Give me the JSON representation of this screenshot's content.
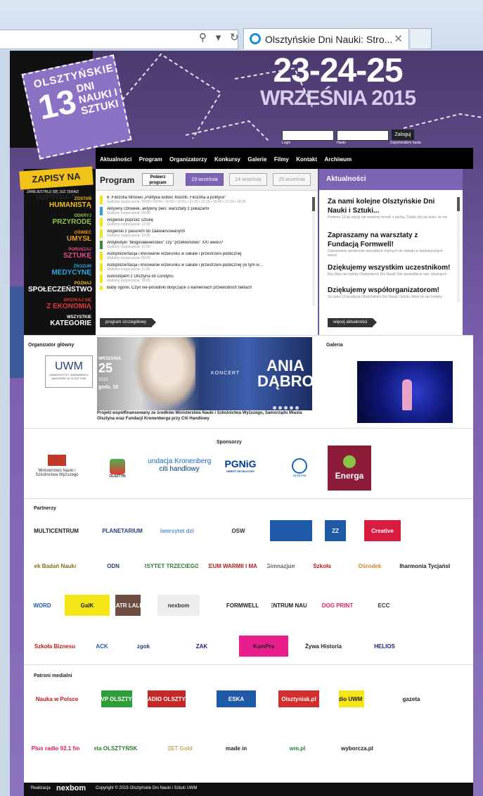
{
  "browser": {
    "tab_title": "Olsztyńskie Dni Nauki: Stro...",
    "tab_close": "✕",
    "url_icons": "⚲ ▾ ↻"
  },
  "header": {
    "logo_line1": "OLSZTYŃSKIE",
    "logo_number": "13",
    "logo_line2": "DNI NAUKI I SZTUKI",
    "dates": "23-24-25",
    "month": "WRZEŚNIA 2015",
    "login_button": "Zaloguj",
    "login_label": "Login",
    "password_label": "Hasło",
    "forgot_label": "Zapomniałem hasła"
  },
  "facebook_label": "facebook",
  "sidebar": {
    "signup": "ZAPISY NA IMPREZY!",
    "signup_sub": "ZAREJESTRUJ SIĘ JUŻ TERAZ!",
    "items": [
      {
        "a": "ZOSTAŃ",
        "b": "HUMANISTĄ"
      },
      {
        "a": "ODKRYJ",
        "b": "PRZYRODĘ"
      },
      {
        "a": "OŚWIEĆ",
        "b": "UMYSŁ"
      },
      {
        "a": "PORUSZAJ",
        "b": "SZTUKĘ"
      },
      {
        "a": "ZROZUM",
        "b": "MEDYCYNĘ"
      },
      {
        "a": "POZNAJ",
        "b": "SPOŁECZEŃSTWO"
      },
      {
        "a": "SPOTKAJ SIĘ",
        "b": "Z EKONOMIĄ"
      },
      {
        "a": "WSZYSTKIE",
        "b": "KATEGORIE"
      }
    ]
  },
  "nav": [
    "Aktualności",
    "Program",
    "Organizatorzy",
    "Konkursy",
    "Galerie",
    "Filmy",
    "Kontakt",
    "Archiwum"
  ],
  "program": {
    "title": "Program",
    "download": "Pobierz program",
    "days": [
      "23 września",
      "24 września",
      "25 września"
    ],
    "events": [
      {
        "title": "6. Filozofia filmowo „Polityka wobec filozofii. Filozofia a polityce\"",
        "hours": "Godziny rozpoczęcia: 09:00 • 09:45 • 10:15 • 10:50 • 11:25 • 12:15 • 16:00 • 17:10 • 18:30",
        "color": "#f5e619"
      },
      {
        "title": "Aktywny człowiek, aktywny pies: warsztaty z pokazami",
        "hours": "Godziny rozpoczęcia: 09:00",
        "color": "#2f9fdd"
      },
      {
        "title": "Angielski poprzez sztukę",
        "hours": "Godziny rozpoczęcia: 12:00",
        "color": "#f5e619"
      },
      {
        "title": "Angielski z pasurem do zaawansowanych",
        "hours": "Godziny rozpoczęcia: 10:30",
        "color": "#f5e619"
      },
      {
        "title": "Antybiotyki \"błogosławieństwo\" czy \"przekleństwo\" XXI wieku?",
        "hours": "Godziny rozpoczęcia: 10:30",
        "color": "#2f8f3a"
      },
      {
        "title": "Autoprezentacja i kreowanie wizerunku w sakale i przestrzeni publicznej",
        "hours": "Godziny rozpoczęcia: 09:30",
        "color": "#f5e619"
      },
      {
        "title": "Autoprezentacja i kreowanie wizerunku w sakale i przestrzeni publicznej (w tym w...",
        "hours": "Godziny rozpoczęcia: 11:30",
        "color": "#f5e619"
      },
      {
        "title": "Autostopem z Olsztyna do Londynu",
        "hours": "Godziny rozpoczęcia: 10:00",
        "color": "#f5e619"
      },
      {
        "title": "Baby ogórki. Czyli nie-poradniki dotyczące o kamieniach przewodnich faktach",
        "hours": "",
        "color": "#f5e619"
      }
    ],
    "detail_button": "program szczegółowy"
  },
  "news": {
    "title": "Aktualności",
    "items": [
      {
        "h": "Za nami kolejne Olsztyńskie Dni Nauki i Sztuki...",
        "d": "Pomimo 13-tej edycji nie możemy mówić o pechu. Dzięki obj się dużo, że nie"
      },
      {
        "h": "Zapraszamy na warsztaty z Fundacją Formwell!",
        "d": "Zapraszamy serdecznie wszystkich chętnych do udziału w fantastycznych warsz"
      },
      {
        "h": "Dziękujemy wszystkim uczestnikom!",
        "d": "Bez Was nie byłoby Olsztyńskich Dni Nauki! Nie zawiedliście nas, dziękujem"
      },
      {
        "h": "Dziękujemy współorganizatorom!",
        "d": "Za nami 13-ta edycja Olsztyńskich Dni Nauki i Sztuki, które po raz kolejny"
      }
    ],
    "more_button": "więcej aktualności"
  },
  "organizer": {
    "label": "Organizator główny",
    "logo": "UWM",
    "logo_sub": "UNIWERSYTET WARMIŃSKO-MAZURSKI W OLSZTYNIE"
  },
  "banner": {
    "day": "25",
    "month": "WRZEŚNIA",
    "year": "2015",
    "hour": "godz. 18",
    "concert": "KONCERT",
    "artist": "ANIA DĄBROWSKA",
    "caption": "Projekt współfinansowany ze środków Ministerstwa Nauki i Szkolnictwa Wyższego, Samorządu Miasta Olsztyna oraz Fundacji Kronenberga przy Citi Handlowy"
  },
  "gallery": {
    "label": "Galeria"
  },
  "sponsors": {
    "label": "Sponsorzy",
    "ministry": "Ministerstwo Nauki i Szkolnictwa Wyższego",
    "olsztyn": "OLSZTYN",
    "kronenberg": "Fundacja Kronenberga",
    "citi": "citi handlowy",
    "pgnig": "PGNiG",
    "pgnig_sub": "OBRÓT DETALICZNY",
    "olsztyn2": "OLSZTYN",
    "energa": "Energa"
  },
  "partners": {
    "label": "Partnerzy",
    "row1": [
      "MULTICENTRUM",
      "PLANETARIUM",
      "Uniwersytet dzieci",
      "OSW",
      "dobrenauki",
      "ZZ",
      "Creative"
    ],
    "row2": [
      "Ośrodek Badań Naukowych",
      "ODN",
      "UNIWERSYTET TRZECIEGO WIEKU",
      "MUZEUM WARMII I MAZUR",
      "Gimnazjum",
      "Szkoła",
      "Ośrodek",
      "Filharmonia Tycjańska"
    ],
    "row3": [
      "WORD",
      "GaIK",
      "TEATR LALEK",
      "nexbom",
      "FORMWELL",
      "CENTRUM NAUKI",
      "DOG PRINT",
      "ECC"
    ],
    "row4": [
      "Szkoła Biznesu",
      "ACK",
      "zgok",
      "ZAK",
      "KamPra",
      "Żywa Historia",
      "HELIOS"
    ]
  },
  "media": {
    "label": "Patroni medialni",
    "row1": [
      "Nauka w Polsce",
      "TVP OLSZTYN",
      "RADIO OLSZTYN",
      "ESKA",
      "Olsztyniak.pl",
      "Radio UWM FM",
      "gazeta"
    ],
    "row2": [
      "Plus radio 92.1 fm",
      "gazeta OLSZTYŃSKA.pl",
      "ZET Gold",
      "made in",
      "wm.pl",
      "wyborcza.pl"
    ]
  },
  "footer": {
    "realization": "Realizacja",
    "nexbom": "nexbom",
    "copyright": "Copyright © 2015 Olsztyńskie Dni Nauki i Sztuki UWM"
  }
}
